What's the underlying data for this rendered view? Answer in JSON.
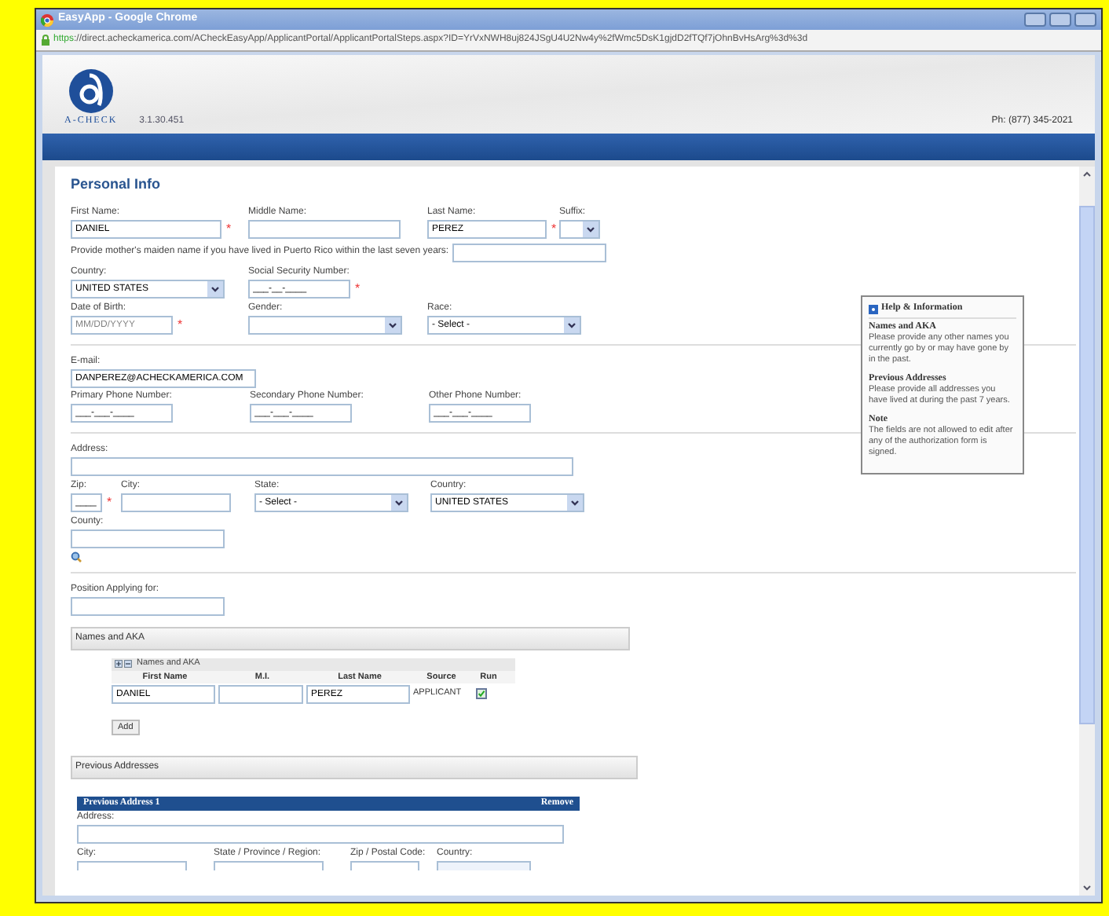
{
  "window": {
    "title": "EasyApp - Google Chrome"
  },
  "address_bar": {
    "scheme": "https",
    "rest": "://direct.acheckamerica.com/ACheckEasyApp/ApplicantPortal/ApplicantPortalSteps.aspx?ID=YrVxNWH8uj824JSgU4U2Nw4y%2fWmc5DsK1gjdD2fTQf7jOhnBvHsArg%3d%3d"
  },
  "header": {
    "logo_text": "A-CHECK",
    "version": "3.1.30.451",
    "phone": "Ph: (877) 345-2021"
  },
  "section_title": "Personal Info",
  "required_mark": "*",
  "name_row": [
    {
      "label": "First Name:",
      "value": "DANIEL",
      "required": true
    },
    {
      "label": "Middle Name:"
    },
    {
      "label": "Last Name:",
      "value": "PEREZ",
      "required": true
    }
  ],
  "suffix": {
    "label": "Suffix:"
  },
  "maiden": {
    "label": "Provide mother's maiden name if you have lived in Puerto Rico within the last seven years:"
  },
  "id_row": [
    {
      "kind": "select",
      "label": "Country:",
      "value": "UNITED STATES"
    },
    {
      "kind": "text",
      "label": "Social Security Number:",
      "value": "___-__-____",
      "required": true
    }
  ],
  "birth_row": [
    {
      "kind": "text",
      "label": "Date of Birth:",
      "placeholder": "MM/DD/YYYY",
      "required": true
    },
    {
      "kind": "select",
      "label": "Gender:"
    },
    {
      "kind": "select",
      "label": "Race:",
      "value": "- Select -"
    }
  ],
  "email": {
    "label": "E-mail:",
    "value": "DANPEREZ@ACHECKAMERICA.COM"
  },
  "phone_row": [
    {
      "label": "Primary Phone Number:",
      "value": "___-___-____"
    },
    {
      "label": "Secondary Phone Number:",
      "value": "___-___-____"
    },
    {
      "label": "Other Phone Number:",
      "value": "___-___-____"
    }
  ],
  "address": {
    "label": "Address:"
  },
  "zip": {
    "label": "Zip:",
    "value": "____",
    "required": true
  },
  "city": {
    "label": "City:"
  },
  "state": {
    "label": "State:",
    "value": "- Select -"
  },
  "country": {
    "label": "Country:",
    "value": "UNITED STATES"
  },
  "county": {
    "label": "County:"
  },
  "position": {
    "label": "Position Applying for:"
  },
  "names_section": {
    "title": "Names and AKA",
    "grid_title": "Names and AKA",
    "columns": [
      "First Name",
      "M.I.",
      "Last Name",
      "Source",
      "Run"
    ],
    "rows": [
      {
        "first": "DANIEL",
        "last": "PEREZ",
        "source": "APPLICANT",
        "run": true
      }
    ],
    "add_button": "Add"
  },
  "previous_section": {
    "title": "Previous Addresses",
    "panel_title": "Previous Address 1",
    "remove": "Remove",
    "address_label": "Address:",
    "labels": [
      "City:",
      "State / Province / Region:",
      "Zip / Postal Code:",
      "Country:"
    ]
  },
  "help": {
    "title": "Help & Information",
    "items": [
      {
        "heading": "Names and AKA",
        "text": "Please provide any other names you currently go by or may have gone by in the past."
      },
      {
        "heading": "Previous Addresses",
        "text": "Please provide all addresses you have lived at during the past 7 years."
      },
      {
        "heading": "Note",
        "text": "The fields are not allowed to edit after any of the authorization form is signed."
      }
    ]
  }
}
